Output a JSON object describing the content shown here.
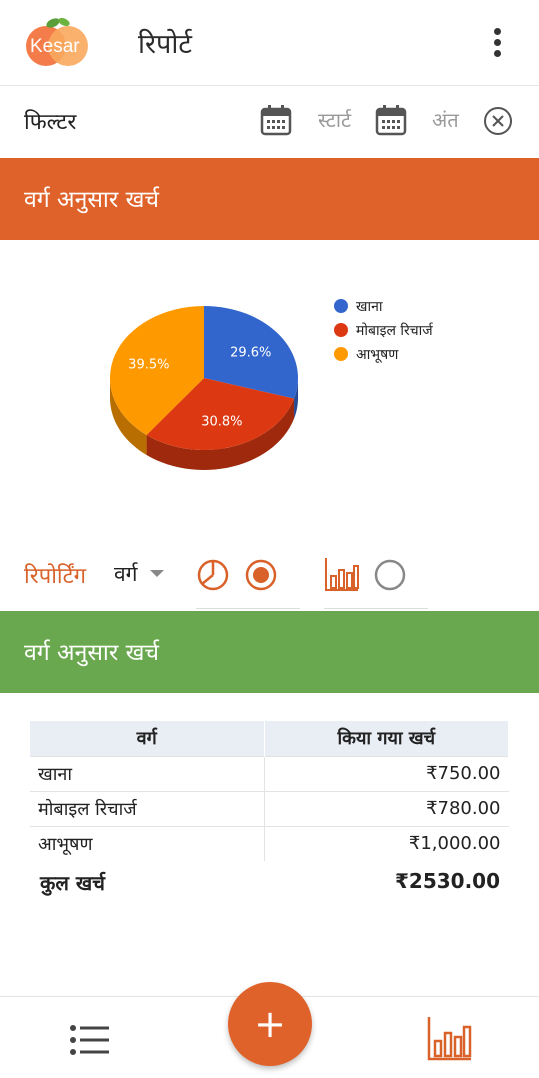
{
  "app": {
    "logo_text": "Kesar",
    "title": "रिपोर्ट"
  },
  "filter": {
    "label": "फिल्टर",
    "start_label": "स्टार्ट",
    "end_label": "अंत"
  },
  "pie_section": {
    "header": "वर्ग अनुसार खर्च"
  },
  "chart_data": {
    "type": "pie",
    "categories": [
      "खाना",
      "मोबाइल रिचार्ज",
      "आभूषण"
    ],
    "values": [
      29.6,
      30.8,
      39.5
    ],
    "labels": [
      "29.6%",
      "30.8%",
      "39.5%"
    ],
    "colors": [
      "#3366cc",
      "#dc3912",
      "#ff9900"
    ],
    "legend_position": "right"
  },
  "reporting": {
    "label": "रिपोर्टिंग",
    "group_by_value": "वर्ग",
    "view_options": [
      {
        "icon": "pie-chart-icon",
        "selected": true
      },
      {
        "icon": "bar-chart-icon",
        "selected": false
      }
    ]
  },
  "table_section": {
    "header": "वर्ग अनुसार खर्च",
    "columns": [
      "वर्ग",
      "किया गया खर्च"
    ],
    "rows": [
      {
        "name": "खाना",
        "amount": "₹750.00"
      },
      {
        "name": "मोबाइल रिचार्ज",
        "amount": "₹780.00"
      },
      {
        "name": "आभूषण",
        "amount": "₹1,000.00"
      }
    ],
    "total_label": "कुल खर्च",
    "total_value": "₹2530.00"
  },
  "fab": {
    "label": "+"
  },
  "colors": {
    "accent": "#e0622b",
    "green_band": "#6aa84f",
    "table_header": "#e9eef5"
  }
}
